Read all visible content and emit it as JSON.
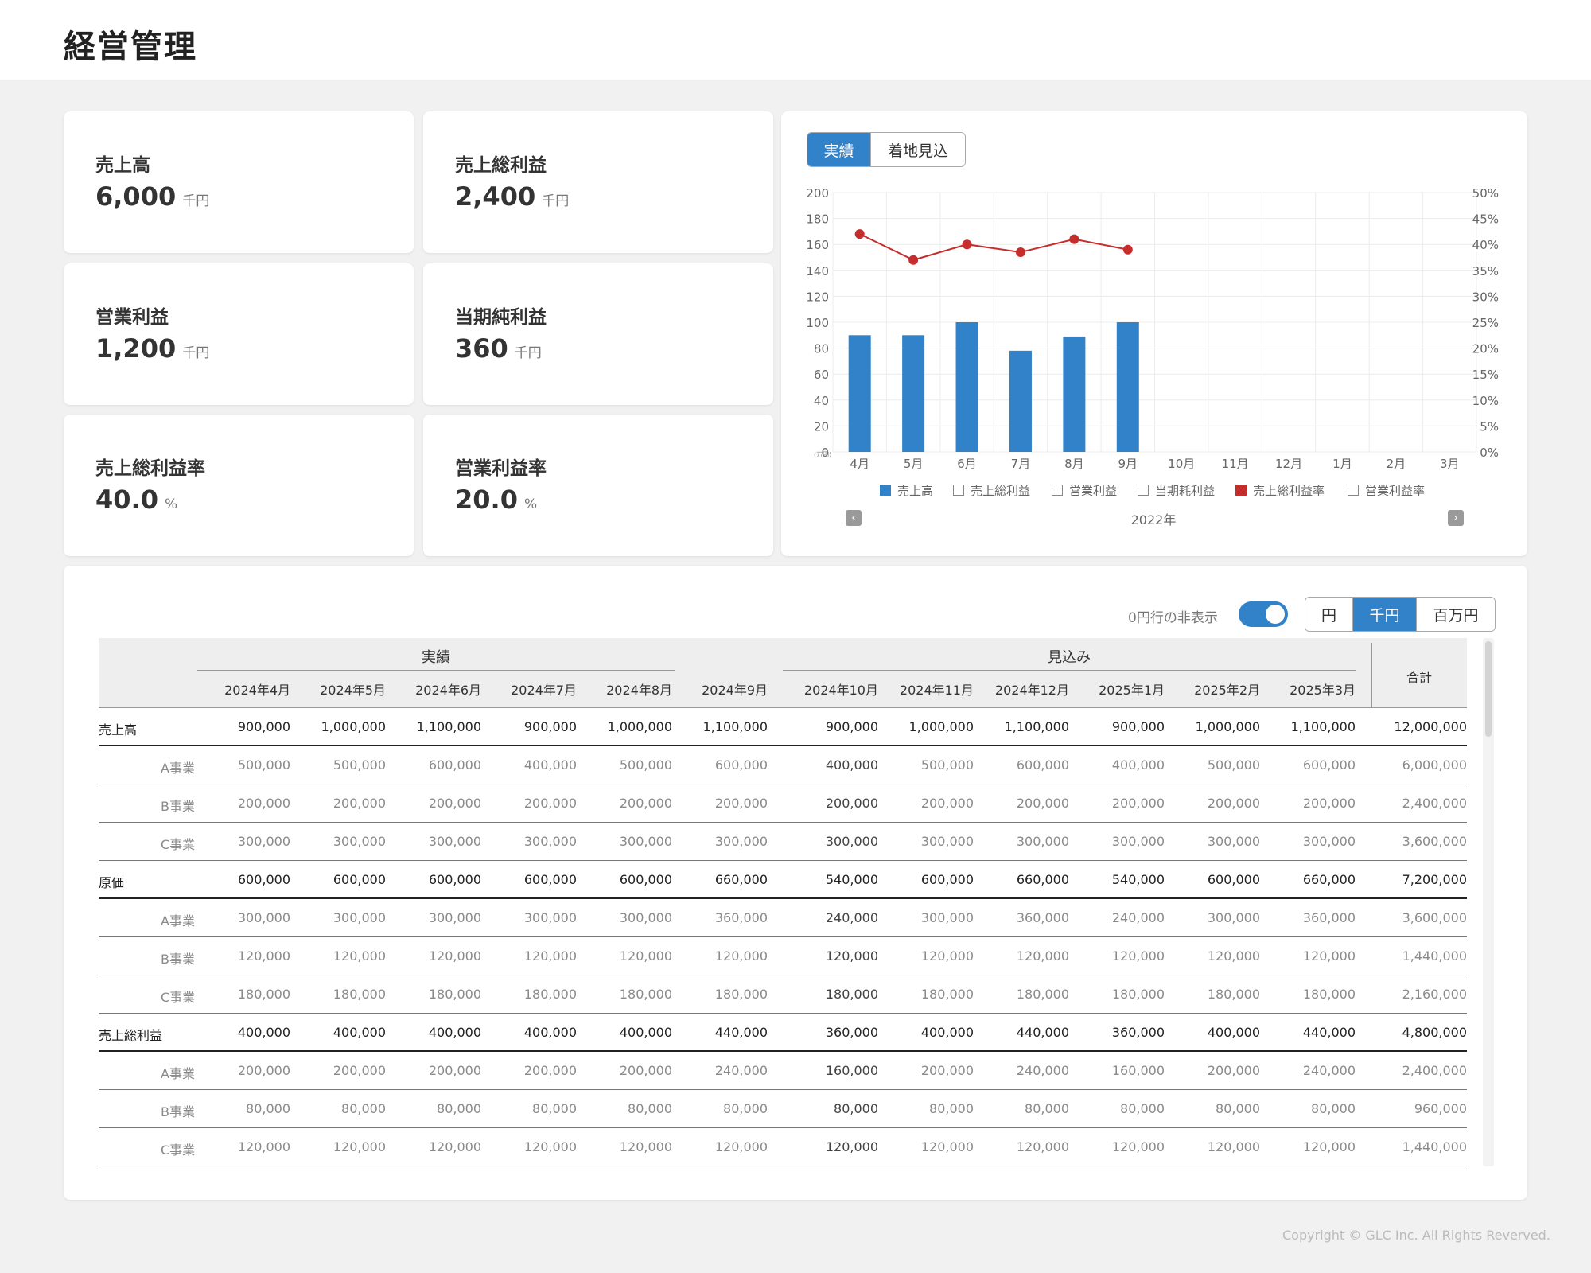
{
  "header": {
    "title": "経営管理"
  },
  "kpis": [
    {
      "label": "売上高",
      "value": "6,000",
      "unit": "千円"
    },
    {
      "label": "売上総利益",
      "value": "2,400",
      "unit": "千円"
    },
    {
      "label": "営業利益",
      "value": "1,200",
      "unit": "千円"
    },
    {
      "label": "当期純利益",
      "value": "360",
      "unit": "千円"
    },
    {
      "label": "売上総利益率",
      "value": "40.0",
      "unit": "%"
    },
    {
      "label": "営業利益率",
      "value": "20.0",
      "unit": "%"
    }
  ],
  "chart_tabs": {
    "actual": "実績",
    "forecast": "着地見込",
    "active": "actual"
  },
  "chart_data": {
    "type": "bar",
    "categories": [
      "4月",
      "5月",
      "6月",
      "7月",
      "8月",
      "9月",
      "10月",
      "11月",
      "12月",
      "1月",
      "2月",
      "3月"
    ],
    "series": [
      {
        "name": "売上高",
        "type": "bar",
        "axis": "left",
        "values": [
          90,
          90,
          100,
          78,
          89,
          100,
          null,
          null,
          null,
          null,
          null,
          null
        ],
        "color": "#3182c8"
      },
      {
        "name": "売上総利益率",
        "type": "line",
        "axis": "right",
        "values": [
          42,
          37,
          40,
          38.5,
          41,
          39,
          null,
          null,
          null,
          null,
          null,
          null
        ],
        "color": "#c62d2d"
      }
    ],
    "y_left": {
      "ylim": [
        0,
        200
      ],
      "ticks": [
        "0",
        "20",
        "40",
        "60",
        "80",
        "100",
        "120",
        "140",
        "160",
        "180",
        "200"
      ],
      "unit": "(万円)"
    },
    "y_right": {
      "ylim": [
        0,
        50
      ],
      "ticks": [
        "0%",
        "5%",
        "10%",
        "15%",
        "20%",
        "25%",
        "30%",
        "35%",
        "40%",
        "45%",
        "50%"
      ]
    },
    "legend": [
      {
        "label": "売上高",
        "checked": true,
        "color": "#3182c8"
      },
      {
        "label": "売上総利益",
        "checked": false
      },
      {
        "label": "営業利益",
        "checked": false
      },
      {
        "label": "当期耗利益",
        "checked": false
      },
      {
        "label": "売上総利益率",
        "checked": true,
        "color": "#c62d2d"
      },
      {
        "label": "営業利益率",
        "checked": false
      }
    ],
    "xlabel": "2022年",
    "grid": true
  },
  "table_controls": {
    "hide_zero_label": "0円行の非表示",
    "hide_zero_on": true,
    "units": [
      "円",
      "千円",
      "百万円"
    ],
    "active_unit": "千円"
  },
  "table": {
    "group_actual": "実績",
    "group_forecast": "見込み",
    "total_label": "合計",
    "columns": [
      "2024年4月",
      "2024年5月",
      "2024年6月",
      "2024年7月",
      "2024年8月",
      "2024年9月",
      "2024年10月",
      "2024年11月",
      "2024年12月",
      "2025年1月",
      "2025年2月",
      "2025年3月"
    ],
    "rows": [
      {
        "label": "売上高",
        "main": true,
        "cells": [
          "900,000",
          "1,000,000",
          "1,100,000",
          "900,000",
          "1,000,000",
          "1,100,000",
          "900,000",
          "1,000,000",
          "1,100,000",
          "900,000",
          "1,000,000",
          "1,100,000"
        ],
        "total": "12,000,000"
      },
      {
        "label": "A事業",
        "main": false,
        "cells": [
          "500,000",
          "500,000",
          "600,000",
          "400,000",
          "500,000",
          "600,000",
          "400,000",
          "500,000",
          "600,000",
          "400,000",
          "500,000",
          "600,000"
        ],
        "total": "6,000,000"
      },
      {
        "label": "B事業",
        "main": false,
        "cells": [
          "200,000",
          "200,000",
          "200,000",
          "200,000",
          "200,000",
          "200,000",
          "200,000",
          "200,000",
          "200,000",
          "200,000",
          "200,000",
          "200,000"
        ],
        "total": "2,400,000"
      },
      {
        "label": "C事業",
        "main": false,
        "cells": [
          "300,000",
          "300,000",
          "300,000",
          "300,000",
          "300,000",
          "300,000",
          "300,000",
          "300,000",
          "300,000",
          "300,000",
          "300,000",
          "300,000"
        ],
        "total": "3,600,000"
      },
      {
        "label": "原価",
        "main": true,
        "cells": [
          "600,000",
          "600,000",
          "600,000",
          "600,000",
          "600,000",
          "660,000",
          "540,000",
          "600,000",
          "660,000",
          "540,000",
          "600,000",
          "660,000"
        ],
        "total": "7,200,000"
      },
      {
        "label": "A事業",
        "main": false,
        "cells": [
          "300,000",
          "300,000",
          "300,000",
          "300,000",
          "300,000",
          "360,000",
          "240,000",
          "300,000",
          "360,000",
          "240,000",
          "300,000",
          "360,000"
        ],
        "total": "3,600,000"
      },
      {
        "label": "B事業",
        "main": false,
        "cells": [
          "120,000",
          "120,000",
          "120,000",
          "120,000",
          "120,000",
          "120,000",
          "120,000",
          "120,000",
          "120,000",
          "120,000",
          "120,000",
          "120,000"
        ],
        "total": "1,440,000"
      },
      {
        "label": "C事業",
        "main": false,
        "cells": [
          "180,000",
          "180,000",
          "180,000",
          "180,000",
          "180,000",
          "180,000",
          "180,000",
          "180,000",
          "180,000",
          "180,000",
          "180,000",
          "180,000"
        ],
        "total": "2,160,000"
      },
      {
        "label": "売上総利益",
        "main": true,
        "cells": [
          "400,000",
          "400,000",
          "400,000",
          "400,000",
          "400,000",
          "440,000",
          "360,000",
          "400,000",
          "440,000",
          "360,000",
          "400,000",
          "440,000"
        ],
        "total": "4,800,000"
      },
      {
        "label": "A事業",
        "main": false,
        "cells": [
          "200,000",
          "200,000",
          "200,000",
          "200,000",
          "200,000",
          "240,000",
          "160,000",
          "200,000",
          "240,000",
          "160,000",
          "200,000",
          "240,000"
        ],
        "total": "2,400,000"
      },
      {
        "label": "B事業",
        "main": false,
        "cells": [
          "80,000",
          "80,000",
          "80,000",
          "80,000",
          "80,000",
          "80,000",
          "80,000",
          "80,000",
          "80,000",
          "80,000",
          "80,000",
          "80,000"
        ],
        "total": "960,000"
      },
      {
        "label": "C事業",
        "main": false,
        "cells": [
          "120,000",
          "120,000",
          "120,000",
          "120,000",
          "120,000",
          "120,000",
          "120,000",
          "120,000",
          "120,000",
          "120,000",
          "120,000",
          "120,000"
        ],
        "total": "1,440,000"
      }
    ]
  },
  "footer": {
    "copyright": "Copyright ©  GLC Inc. All Rights Reverved."
  }
}
